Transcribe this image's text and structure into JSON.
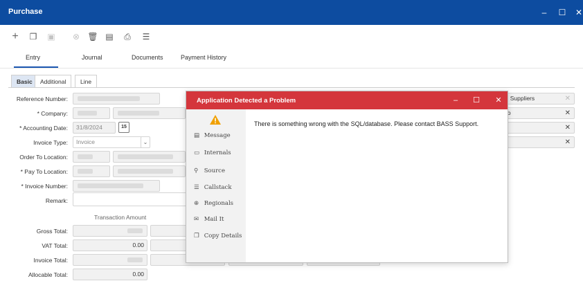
{
  "window": {
    "title": "Purchase"
  },
  "toolbar": {
    "icons": [
      "plus-icon",
      "copy-icon",
      "save-icon",
      "cancel-icon",
      "delete-icon",
      "notes-icon",
      "print-icon",
      "list-icon"
    ]
  },
  "tabs": [
    {
      "label": "Entry",
      "active": true
    },
    {
      "label": "Journal"
    },
    {
      "label": "Documents"
    },
    {
      "label": "Payment History"
    }
  ],
  "subtabs": [
    {
      "label": "Basic",
      "active": true
    },
    {
      "label": "Additional"
    },
    {
      "label": "Line"
    }
  ],
  "form": {
    "reference_number_label": "Reference Number:",
    "company_label": "* Company:",
    "accounting_date_label": "* Accounting Date:",
    "accounting_date_value": "31/8/2024",
    "calendar_day": "15",
    "invoice_type_label": "Invoice Type:",
    "invoice_type_value": "Invoice",
    "order_to_location_label": "Order To Location:",
    "pay_to_location_label": "* Pay To Location:",
    "invoice_number_label": "* Invoice Number:",
    "remark_label": "Remark:"
  },
  "totals": {
    "column_header": "Transaction Amount",
    "gross_total_label": "Gross Total:",
    "vat_total_label": "VAT Total:",
    "vat_total_value": "0.00",
    "invoice_total_label": "Invoice Total:",
    "allocable_total_label": "Allocable Total:",
    "allocable_total_value": "0.00"
  },
  "right_fields": [
    {
      "value": "nal Suppliers",
      "muted_x": true
    },
    {
      "value": "erto",
      "muted_x": false
    },
    {
      "value": "",
      "muted_x": false
    },
    {
      "value": "",
      "muted_x": false
    }
  ],
  "dialog": {
    "title": "Application Detected a Problem",
    "message": "There is something wrong with the SQL/database. Please contact BASS Support.",
    "title_color": "#d4363c",
    "side_items": [
      {
        "icon": "message-icon",
        "glyph": "▤",
        "label": "Message"
      },
      {
        "icon": "internals-icon",
        "glyph": "▭",
        "label": "Internals"
      },
      {
        "icon": "source-icon",
        "glyph": "⚲",
        "label": "Source"
      },
      {
        "icon": "callstack-icon",
        "glyph": "☰",
        "label": "Callstack"
      },
      {
        "icon": "globe-icon",
        "glyph": "⊕",
        "label": "Regionals"
      },
      {
        "icon": "mail-icon",
        "glyph": "✉",
        "label": "Mail It"
      },
      {
        "icon": "copy-icon",
        "glyph": "❐",
        "label": "Copy Details"
      }
    ]
  },
  "colors": {
    "titlebar": "#0d4ca0",
    "accent": "#1a56b0",
    "warning": "#f0a000"
  }
}
